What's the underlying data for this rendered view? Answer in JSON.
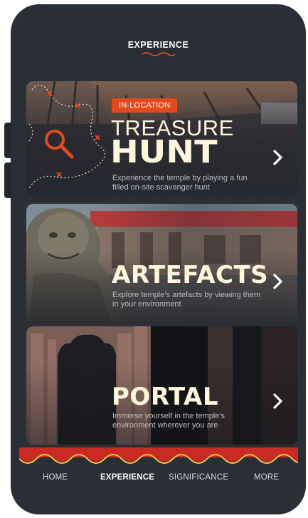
{
  "header": {
    "title": "EXPERIENCE"
  },
  "cards": [
    {
      "badge": "IN-LOCATION",
      "title_light": "TREASURE",
      "title_heavy": "HUNT",
      "description": "Experience the temple by playing a fun filled on-site scavanger hunt"
    },
    {
      "title_heavy": "ARTEFACTS",
      "description": "Explore temple's artefacts by viewing them in your environment"
    },
    {
      "title_heavy": "PORTAL",
      "description": "Immerse yourself in the temple's environment wherever you are"
    }
  ],
  "nav": {
    "items": [
      {
        "label": "HOME"
      },
      {
        "label": "EXPERIENCE"
      },
      {
        "label": "SIGNIFICANCE"
      },
      {
        "label": "MORE"
      }
    ],
    "active": "EXPERIENCE"
  },
  "colors": {
    "background": "#2a2e35",
    "accent": "#e24a1f",
    "banner_red": "#c92a22",
    "banner_gold": "#f2c14a",
    "title_cream": "#fff6de"
  },
  "icons": [
    "search-icon",
    "chevron-right-icon"
  ]
}
